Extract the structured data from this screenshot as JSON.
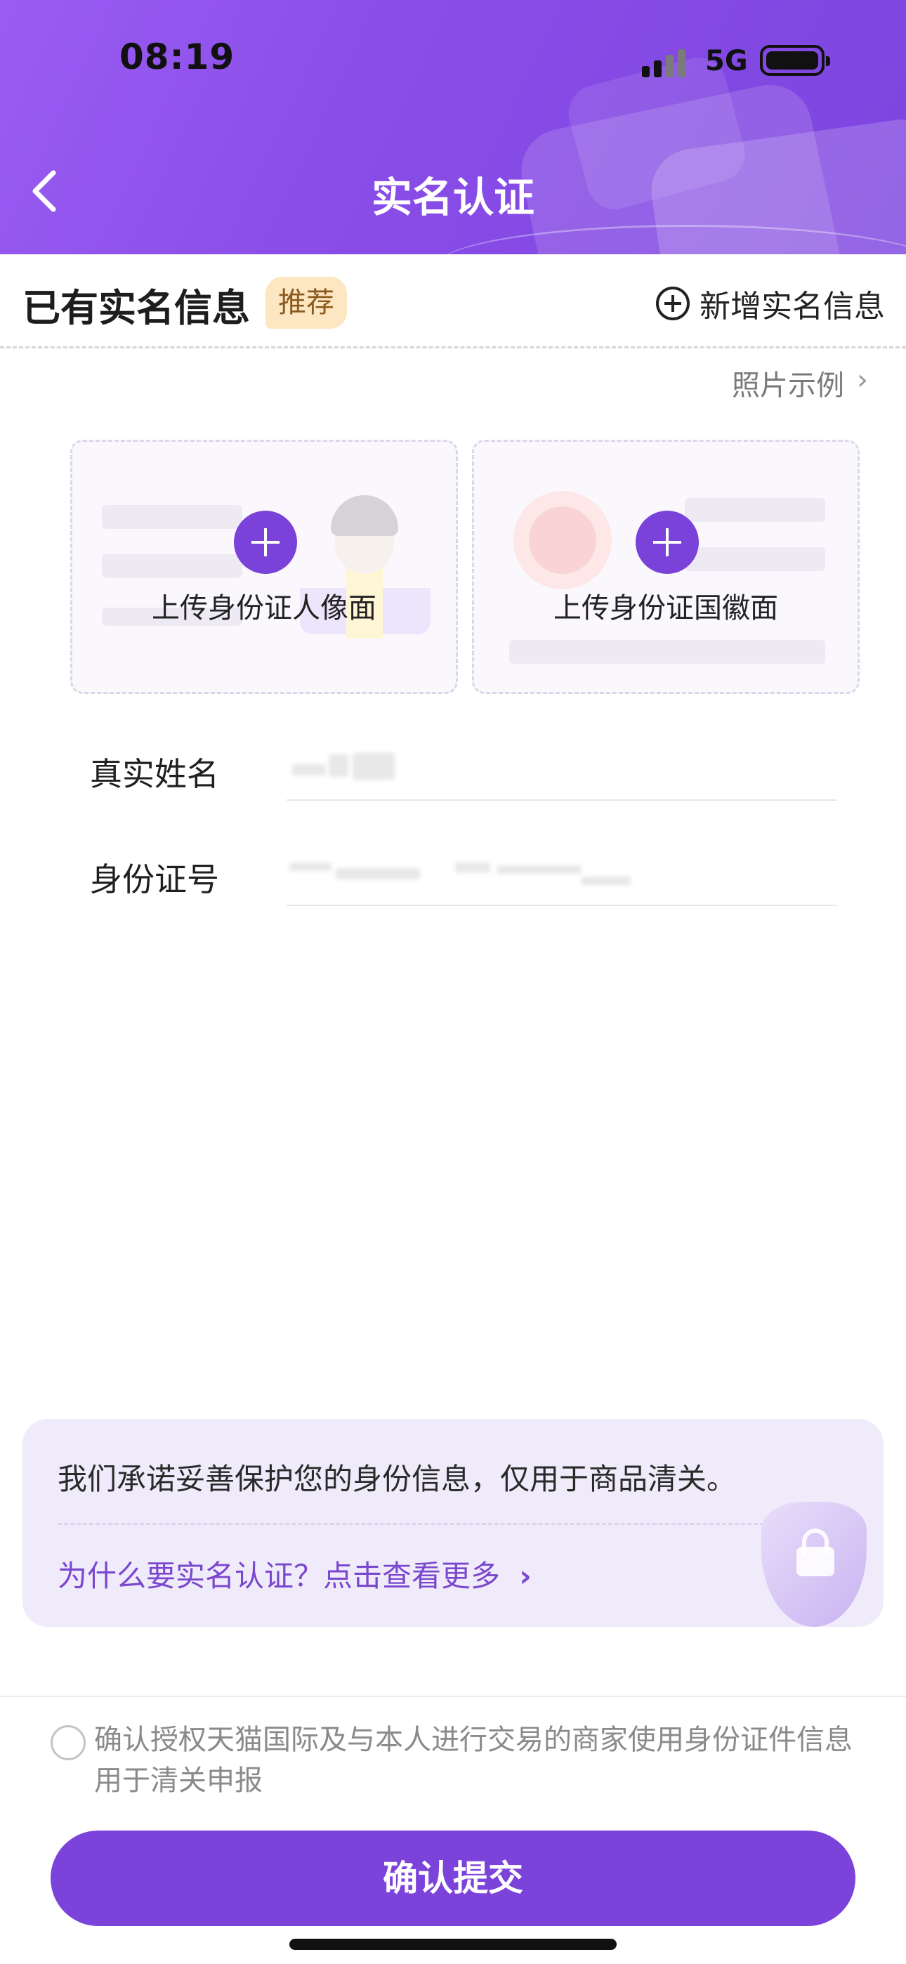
{
  "status_bar": {
    "time": "08:19",
    "network": "5G"
  },
  "header": {
    "title": "实名认证",
    "back_icon": "chevron-left-icon"
  },
  "section": {
    "title": "已有实名信息",
    "badge": "推荐",
    "add_label": "新增实名信息",
    "add_icon": "plus-circle-icon"
  },
  "photo_example": {
    "label": "照片示例",
    "chevron": "›"
  },
  "upload": {
    "front_label": "上传身份证人像面",
    "back_label": "上传身份证国徽面"
  },
  "form": {
    "name_label": "真实姓名",
    "id_label": "身份证号"
  },
  "promise": {
    "text": "我们承诺妥善保护您的身份信息，仅用于商品清关。",
    "link": "为什么要实名认证？点击查看更多",
    "chevron": "›"
  },
  "agreement": {
    "text": "确认授权天猫国际及与本人进行交易的商家使用身份证件信息用于清关申报",
    "checked": false
  },
  "submit": {
    "label": "确认提交"
  },
  "colors": {
    "primary": "#7c43da",
    "header_gradient_start": "#9a5cf2",
    "badge_bg": "#fde6c2",
    "promise_bg": "#f0ebfa"
  }
}
